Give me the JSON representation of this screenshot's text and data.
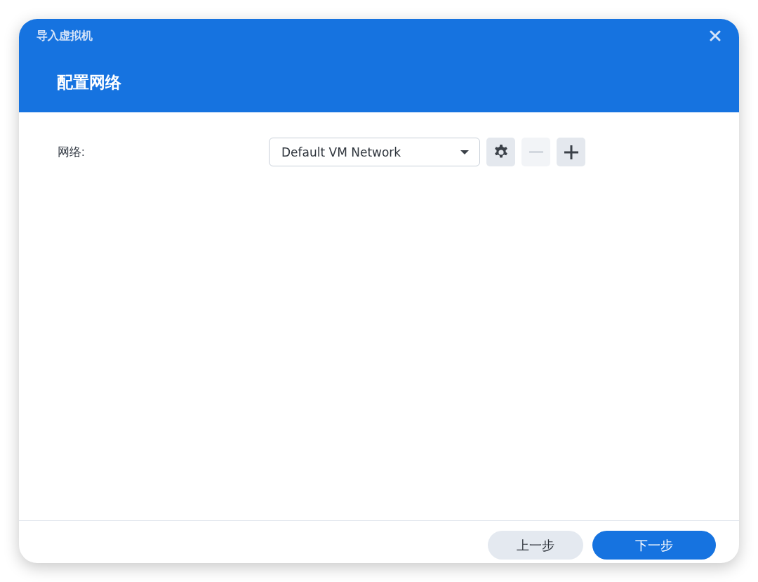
{
  "window": {
    "title": "导入虚拟机"
  },
  "step": {
    "title": "配置网络"
  },
  "fields": [
    {
      "label": "网络:",
      "kind": "select",
      "value": "Default VM Network"
    }
  ],
  "field_buttons": [
    {
      "kind": "settings",
      "disabled": false
    },
    {
      "kind": "remove",
      "disabled": true
    },
    {
      "kind": "add",
      "disabled": false
    }
  ],
  "footer": {
    "buttons": [
      {
        "label": "上一步",
        "kind": "secondary"
      },
      {
        "label": "下一步",
        "kind": "primary"
      }
    ]
  }
}
